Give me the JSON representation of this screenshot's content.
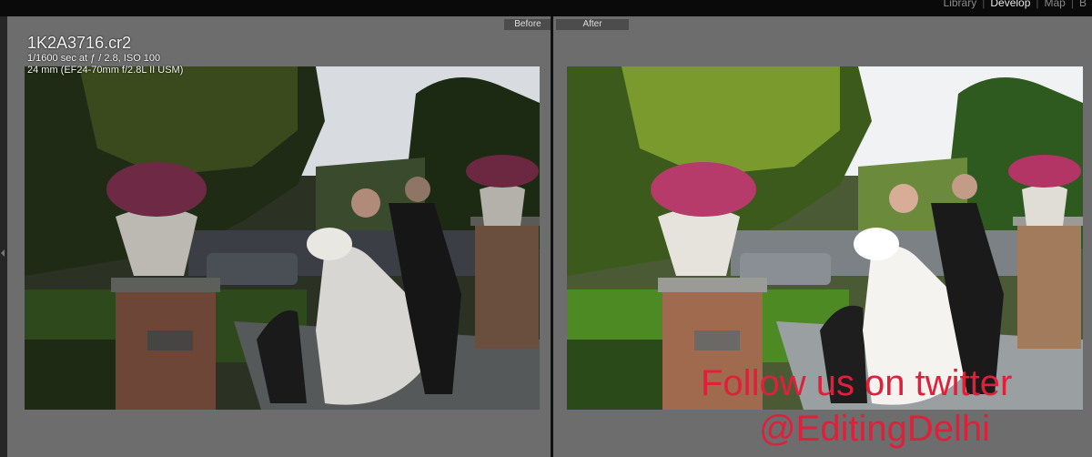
{
  "modules": {
    "library": "Library",
    "sep1": "|",
    "develop": "Develop",
    "sep2": "|",
    "map": "Map",
    "sep3": "|",
    "book": "B"
  },
  "before_pane": {
    "tag": "Before",
    "filename": "1K2A3716.cr2",
    "exposure": "1/1600 sec at ƒ / 2.8, ISO 100",
    "lens": "24 mm (EF24-70mm f/2.8L II USM)"
  },
  "after_pane": {
    "tag": "After"
  },
  "watermark": {
    "line1": "Follow us on twitter",
    "line2": "@EditingDelhi"
  },
  "colors": {
    "accent_watermark": "#e0203a",
    "pane_bg": "#6d6d6d",
    "topbar_bg": "#0a0a0a"
  }
}
